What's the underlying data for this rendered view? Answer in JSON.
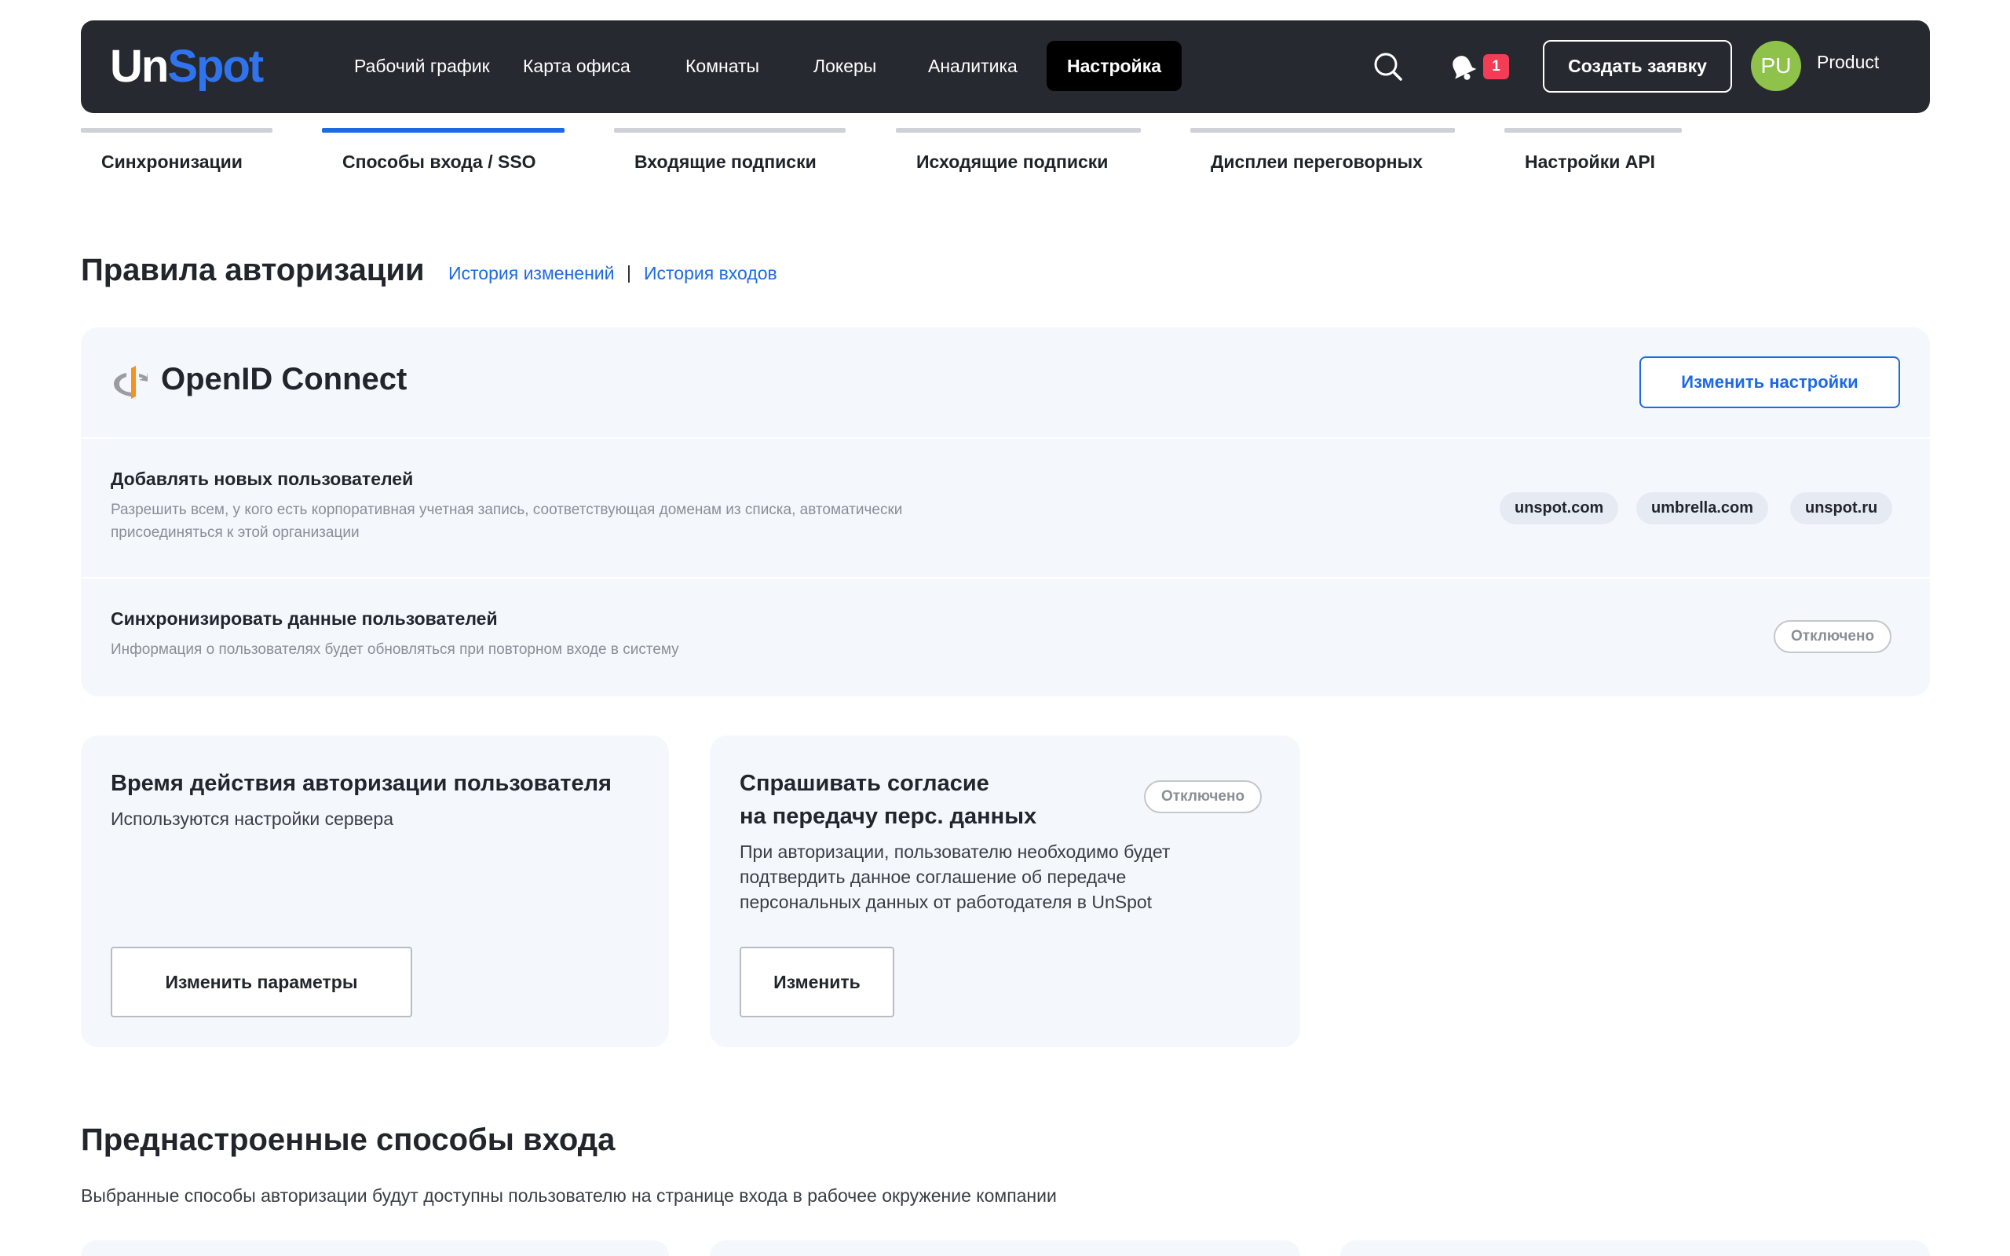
{
  "header": {
    "logo_part1": "Un",
    "logo_part2": "Spot",
    "nav": [
      "Рабочий график",
      "Карта офиса",
      "Комнаты",
      "Локеры",
      "Аналитика",
      "Настройка"
    ],
    "active_nav": "Настройка",
    "search_icon": "search-icon",
    "notifications_icon": "bell-icon",
    "notification_count": "1",
    "create_button": "Создать заявку",
    "avatar_initials": "PU",
    "user_name": "Product"
  },
  "tabs": [
    "Синхронизации",
    "Способы входа / SSO",
    "Входящие подписки",
    "Исходящие подписки",
    "Дисплеи переговорных",
    "Настройки API"
  ],
  "active_tab": "Способы входа / SSO",
  "auth_rules": {
    "title": "Правила авторизации",
    "history_changes": "История изменений",
    "separator": "|",
    "history_logins": "История входов"
  },
  "openid": {
    "icon": "openid-icon",
    "title": "OpenID Connect",
    "edit_button": "Изменить настройки",
    "add_users": {
      "title": "Добавлять новых пользователей",
      "description": "Разрешить всем, у кого есть корпоративная учетная запись, соответствующая доменам из списка, автоматически присоединяться к этой организации",
      "domains": [
        "unspot.com",
        "umbrella.com",
        "unspot.ru"
      ]
    },
    "sync_users": {
      "title": "Синхронизировать данные пользователей",
      "description": "Информация о пользователях будет обновляться при повторном входе в систему",
      "status": "Отключено"
    }
  },
  "session_card": {
    "title": "Время действия авторизации пользователя",
    "text": "Используются настройки сервера",
    "button": "Изменить параметры"
  },
  "consent_card": {
    "title_line1": "Спрашивать согласие",
    "title_line2": "на передачу перс. данных",
    "status": "Отключено",
    "text": "При авторизации, пользователю необходимо будет подтвердить данное соглашение об передаче персональных данных от работодателя в UnSpot",
    "button": "Изменить"
  },
  "presets": {
    "title": "Преднастроенные способы входа",
    "subtitle": "Выбранные способы авторизации будут доступны пользователю на странице входа в рабочее окружение компании"
  },
  "colors": {
    "header_bg": "#26292f",
    "accent": "#1d6ae5",
    "card_bg": "#f4f7fc",
    "badge": "#f23d55",
    "avatar": "#8fc24a"
  }
}
